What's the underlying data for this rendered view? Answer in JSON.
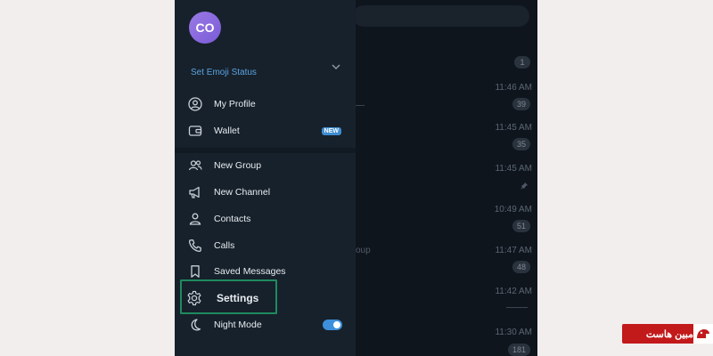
{
  "drawer": {
    "avatar_initials": "CO",
    "emoji_status_label": "Set Emoji Status",
    "items": [
      {
        "label": "My Profile",
        "icon": "user-circle-icon"
      },
      {
        "label": "Wallet",
        "icon": "wallet-icon",
        "badge": "NEW"
      },
      {
        "label": "New Group",
        "icon": "group-icon"
      },
      {
        "label": "New Channel",
        "icon": "megaphone-icon"
      },
      {
        "label": "Contacts",
        "icon": "person-icon"
      },
      {
        "label": "Calls",
        "icon": "phone-icon"
      },
      {
        "label": "Saved Messages",
        "icon": "bookmark-icon"
      },
      {
        "label": "Settings",
        "icon": "gear-icon"
      },
      {
        "label": "Night Mode",
        "icon": "moon-icon",
        "toggle_on": true
      }
    ]
  },
  "chatlist": {
    "rows": [
      {
        "time": "",
        "badge": "1"
      },
      {
        "time": "11:46 AM",
        "badge": "39"
      },
      {
        "time": "11:45 AM",
        "badge": "35"
      },
      {
        "time": "11:45 AM",
        "badge": ""
      },
      {
        "time": "10:49 AM",
        "badge": "51"
      },
      {
        "time": "11:47 AM",
        "badge": "48",
        "snippet": "oup"
      },
      {
        "time": "11:42 AM",
        "badge": ""
      },
      {
        "time": "11:30 AM",
        "badge": "181"
      }
    ]
  },
  "watermark": {
    "text": "مبین هاست"
  },
  "colors": {
    "accent": "#3d8fdb",
    "highlight": "#1f8a5f",
    "drawer_bg": "#17212b"
  }
}
